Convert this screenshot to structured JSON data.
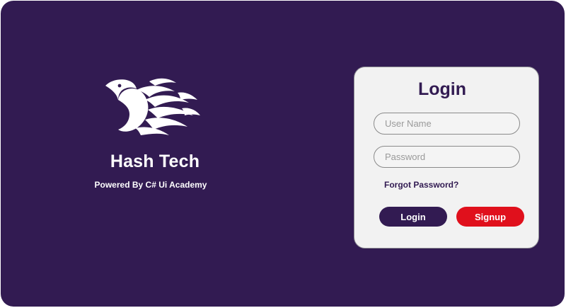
{
  "brand": {
    "logo_icon": "phoenix-bird-icon",
    "title": "Hash Tech",
    "subtitle": "Powered By C# Ui Academy"
  },
  "login": {
    "title": "Login",
    "username_placeholder": "User Name",
    "username_value": "",
    "password_placeholder": "Password",
    "password_value": "",
    "forgot_label": "Forgot Password?",
    "login_label": "Login",
    "signup_label": "Signup"
  },
  "colors": {
    "background": "#321b52",
    "card": "#f2f2f2",
    "primary": "#321b52",
    "signup": "#e0101c",
    "text_light": "#ffffff"
  }
}
